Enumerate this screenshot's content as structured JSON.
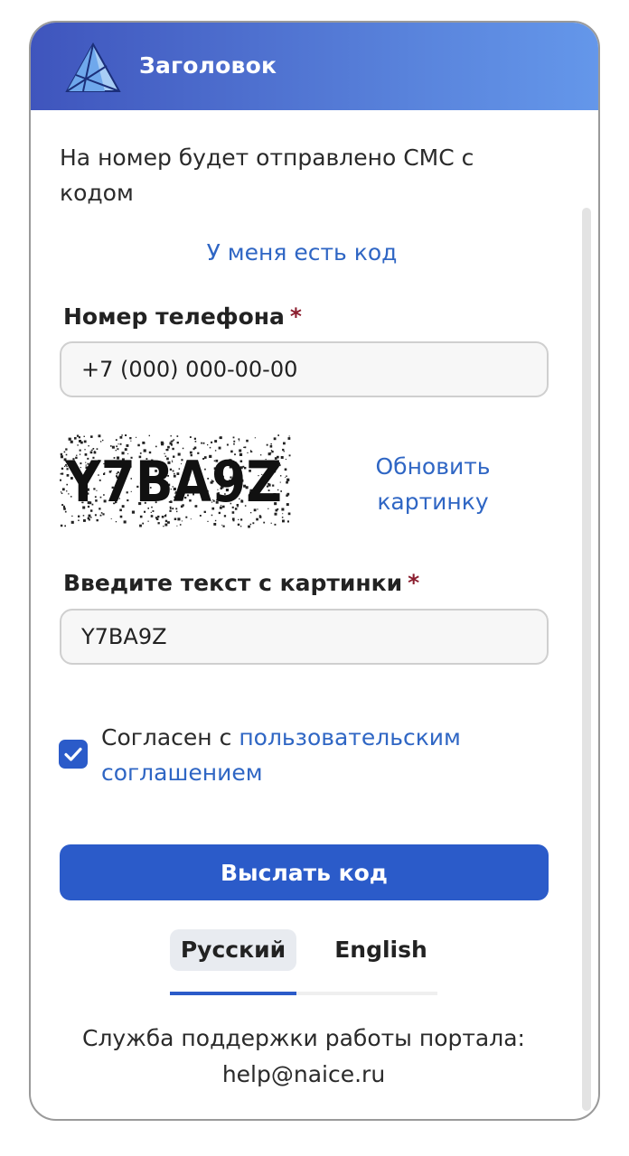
{
  "header": {
    "title": "Заголовок",
    "logo_icon": "triangle-logo-icon"
  },
  "form": {
    "info_text": "На номер будет отправлено СМС с кодом",
    "have_code_link": "У меня есть код",
    "phone_label": "Номер телефона",
    "phone_value": "+7 (000) 000-00-00",
    "required_mark": "*",
    "captcha_image_text": "Y7BA9Z",
    "refresh_captcha_label": "Обновить картинку",
    "captcha_label": "Введите текст с картинки",
    "captcha_value": "Y7BA9Z",
    "agree_checked": true,
    "agree_text": "Согласен с",
    "agree_link": "пользовательским соглашением",
    "submit_label": "Выслать код"
  },
  "languages": {
    "items": [
      "Русский",
      "English"
    ],
    "selected": "Русский"
  },
  "footer": {
    "support_line1": "Служба поддержки работы портала:",
    "support_email": "help@naice.ru"
  },
  "colors": {
    "accent": "#2b5bc9",
    "link": "#2f66c4",
    "header_gradient_start": "#3f55bd",
    "header_gradient_end": "#6497ea",
    "required": "#8b1e2f"
  }
}
